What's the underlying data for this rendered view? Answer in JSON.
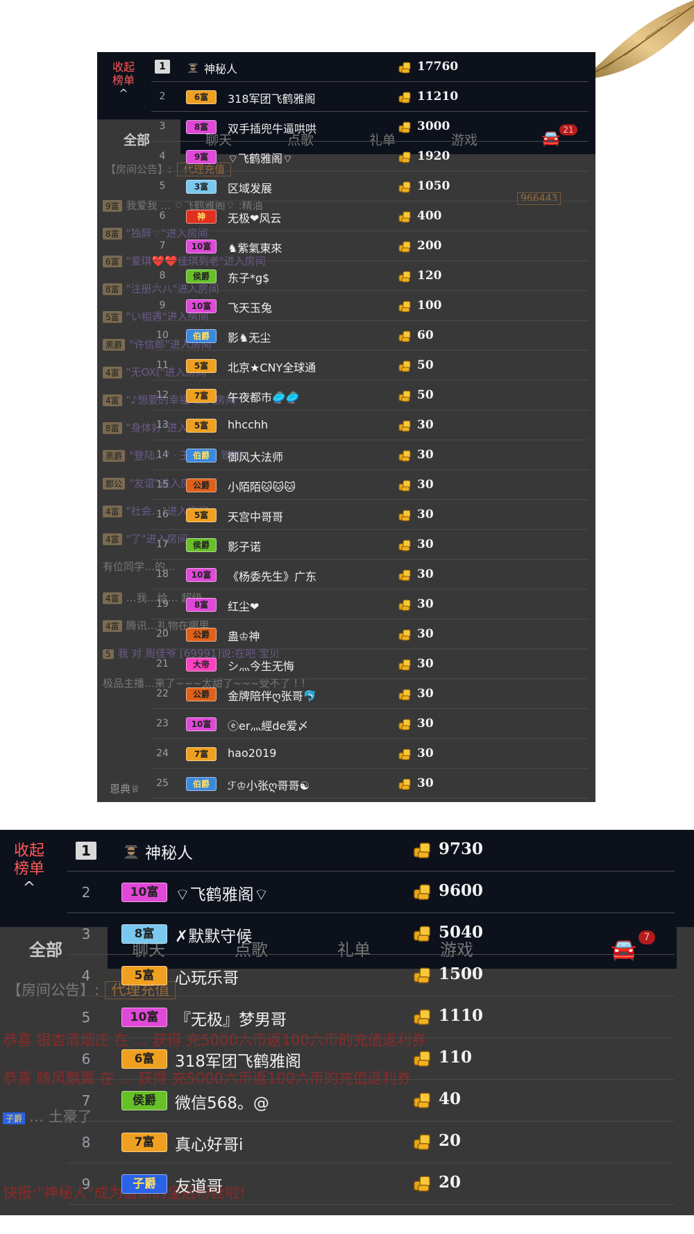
{
  "colors": {
    "header_bg": "#0c111b",
    "board_bg": "#3a3a3a",
    "toggle_red": "#ff5a5a",
    "badge_colors": {
      "富": "#f0a020",
      "宫": "#e048d8",
      "侯爵": "#68c028",
      "伯爵": "#3a88e0",
      "公爵": "#e06018",
      "大帝": "#ff40c0",
      "神": "#e03020",
      "子爵": "#2a62e8",
      "蓝富": "#7ac8f0"
    }
  },
  "icons": {
    "collapse": "chevron-up-icon",
    "coin": "gold-coin-icon",
    "incognito": "incognito-avatar-icon",
    "car": "car-icon"
  },
  "panel1": {
    "toggle": {
      "line1": "收起",
      "line2": "榜单"
    },
    "tabs": [
      "全部",
      "聊天",
      "点歌",
      "礼单",
      "游戏"
    ],
    "car_count": "21",
    "notice_label": "【房间公告】:",
    "notice_cta": "代理充值",
    "room_id": "966443",
    "ghost_lines": [
      {
        "badge": "9富",
        "text": "我爱我 ... ⌔飞鹤雅阁⌔ :精油"
      },
      {
        "badge": "8富",
        "text": "\"独醉⌔\"进入房间"
      },
      {
        "badge": "6富",
        "text": "\"爱琪❤️❤️佳琪到老\"进入房间"
      },
      {
        "badge": "8富",
        "text": "\"注册六八\"进入房间"
      },
      {
        "badge": "5富",
        "text": "\"い相遇\"进入房间"
      },
      {
        "badge": "黑爵",
        "text": "\"许信郎\"进入房间"
      },
      {
        "badge": "4富",
        "text": "\"无OX(\"进入房间"
      },
      {
        "badge": "4富",
        "text": "\"♪想要的幸福\"进入房间"
      },
      {
        "badge": "8富",
        "text": "\"身体好\"进入房间"
      },
      {
        "badge": "黑爵",
        "text": "\"登陆…\"  · 王 ·  王 · 驾到"
      },
      {
        "badge": "郡公",
        "text": "\"友谊\"进入房间"
      },
      {
        "badge": "4富",
        "text": "\"社会…\"进入房间"
      },
      {
        "badge": "4富",
        "text": "\"了\"进入房间"
      },
      {
        "badge": "",
        "text": "有位同学…的…"
      },
      {
        "badge": "4富",
        "text": "…我…给… 超级"
      },
      {
        "badge": "4富",
        "text": "腾讯…礼物在哪里"
      },
      {
        "badge": "5",
        "text": "我 对 周佳爷 [69991]说:在吧 宝贝"
      },
      {
        "badge": "",
        "text": "极品主播…来了~~~太甜了~~~受不了 ! !"
      }
    ],
    "footer_user": "恩典♕",
    "rows": [
      {
        "rank": "1",
        "badge": "",
        "badge_type": "",
        "name": "神秘人",
        "score": "17760"
      },
      {
        "rank": "2",
        "badge": "6富",
        "badge_type": "富",
        "name": "318军团飞鹤雅阁",
        "score": "11210"
      },
      {
        "rank": "3",
        "badge": "8富",
        "badge_type": "宫",
        "name": "双手插兜牛逼哄哄",
        "score": "3000"
      },
      {
        "rank": "4",
        "badge": "9富",
        "badge_type": "宫",
        "name": "⌔飞鹤雅阁⌔",
        "score": "1920"
      },
      {
        "rank": "5",
        "badge": "3富",
        "badge_type": "蓝富",
        "name": "区域发展",
        "score": "1050"
      },
      {
        "rank": "6",
        "badge": "神",
        "badge_type": "神",
        "name": "无极❤风云",
        "score": "400"
      },
      {
        "rank": "7",
        "badge": "10富",
        "badge_type": "宫",
        "name": "♞紫氣東來",
        "score": "200"
      },
      {
        "rank": "8",
        "badge": "侯爵",
        "badge_type": "侯爵",
        "name": "东子*g$",
        "score": "120"
      },
      {
        "rank": "9",
        "badge": "10富",
        "badge_type": "宫",
        "name": "飞天玉兔",
        "score": "100"
      },
      {
        "rank": "10",
        "badge": "伯爵",
        "badge_type": "伯爵",
        "name": "影♞无尘",
        "score": "60"
      },
      {
        "rank": "11",
        "badge": "5富",
        "badge_type": "富",
        "name": "北京★CNY全球通",
        "score": "50"
      },
      {
        "rank": "12",
        "badge": "7富",
        "badge_type": "富",
        "name": "午夜都市🥏🥏",
        "score": "50"
      },
      {
        "rank": "13",
        "badge": "5富",
        "badge_type": "富",
        "name": "hhcchh",
        "score": "30"
      },
      {
        "rank": "14",
        "badge": "伯爵",
        "badge_type": "伯爵",
        "name": "御风大法师",
        "score": "30"
      },
      {
        "rank": "15",
        "badge": "公爵",
        "badge_type": "公爵",
        "name": "小陌陌🐱🐱🐱",
        "score": "30"
      },
      {
        "rank": "16",
        "badge": "5富",
        "badge_type": "富",
        "name": "天宫中哥哥",
        "score": "30"
      },
      {
        "rank": "17",
        "badge": "侯爵",
        "badge_type": "侯爵",
        "name": "影子诺",
        "score": "30"
      },
      {
        "rank": "18",
        "badge": "10富",
        "badge_type": "宫",
        "name": "《杨委先生》广东",
        "score": "30"
      },
      {
        "rank": "19",
        "badge": "8富",
        "badge_type": "宫",
        "name": "红尘❤",
        "score": "30"
      },
      {
        "rank": "20",
        "badge": "公爵",
        "badge_type": "公爵",
        "name": "蛊♔神",
        "score": "30"
      },
      {
        "rank": "21",
        "badge": "大帝",
        "badge_type": "大帝",
        "name": "シ灬今生无悔",
        "score": "30"
      },
      {
        "rank": "22",
        "badge": "公爵",
        "badge_type": "公爵",
        "name": "金牌陪伴ღ张哥🐬",
        "score": "30"
      },
      {
        "rank": "23",
        "badge": "10富",
        "badge_type": "宫",
        "name": "ⓔer灬經de爱〆",
        "score": "30"
      },
      {
        "rank": "24",
        "badge": "7富",
        "badge_type": "富",
        "name": "hao2019",
        "score": "30"
      },
      {
        "rank": "25",
        "badge": "伯爵",
        "badge_type": "伯爵",
        "name": "ℱ♔小张ღ哥哥☯",
        "score": "30"
      }
    ]
  },
  "panel2": {
    "toggle": {
      "line1": "收起",
      "line2": "榜单"
    },
    "tabs": [
      "全部",
      "聊天",
      "点歌",
      "礼单",
      "游戏"
    ],
    "car_count": "7",
    "notice_label": "【房间公告】:",
    "notice_cta": "代理充值",
    "ghost_lines": [
      {
        "badge": "",
        "text": "恭喜 银杏清烟庄 在 … 获得 充5000六币返100六币的充值返利券"
      },
      {
        "badge": "",
        "text": "恭喜 随风飘翼 在 … 获得 充5000六币返100六币的充值返利券"
      },
      {
        "badge": "子爵",
        "text": "… 土豪了"
      },
      {
        "badge": "",
        "text": "快报:\"神秘人\"成为最新的皇冠粉丝啦!"
      }
    ],
    "rows": [
      {
        "rank": "1",
        "badge": "",
        "badge_type": "",
        "name": "神秘人",
        "score": "9730"
      },
      {
        "rank": "2",
        "badge": "10富",
        "badge_type": "宫",
        "name": "⌔飞鹤雅阁⌔",
        "score": "9600"
      },
      {
        "rank": "3",
        "badge": "8富",
        "badge_type": "蓝富",
        "name": "✗默默守候",
        "score": "5040"
      },
      {
        "rank": "4",
        "badge": "5富",
        "badge_type": "富",
        "name": "心玩乐哥",
        "score": "1500"
      },
      {
        "rank": "5",
        "badge": "10富",
        "badge_type": "宫",
        "name": "『无极』梦男哥",
        "score": "1110"
      },
      {
        "rank": "6",
        "badge": "6富",
        "badge_type": "富",
        "name": "318军团飞鹤雅阁",
        "score": "110"
      },
      {
        "rank": "7",
        "badge": "侯爵",
        "badge_type": "侯爵",
        "name": "微信568。@",
        "score": "40"
      },
      {
        "rank": "8",
        "badge": "7富",
        "badge_type": "富",
        "name": "真心好哥i",
        "score": "20"
      },
      {
        "rank": "9",
        "badge": "子爵",
        "badge_type": "子爵",
        "name": "友道哥",
        "score": "20"
      }
    ]
  }
}
